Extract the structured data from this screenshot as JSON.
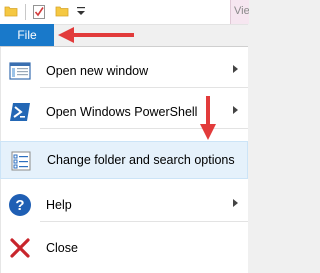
{
  "ribbon": {
    "view_tab_label": "View",
    "file_tab_label": "File"
  },
  "menu": {
    "items": [
      {
        "label": "Open new window",
        "icon": "window-icon",
        "has_submenu": true
      },
      {
        "label": "Open Windows PowerShell",
        "icon": "powershell-icon",
        "has_submenu": true
      },
      {
        "label": "Change folder and search options",
        "icon": "folder-options-icon",
        "has_submenu": false,
        "highlighted": true
      },
      {
        "label": "Help",
        "icon": "help-icon",
        "has_submenu": true
      },
      {
        "label": "Close",
        "icon": "close-icon",
        "has_submenu": false
      }
    ]
  },
  "colors": {
    "file_tab": "#1979ca",
    "highlight": "#e5f1fb",
    "annotation": "#e23b3b"
  }
}
